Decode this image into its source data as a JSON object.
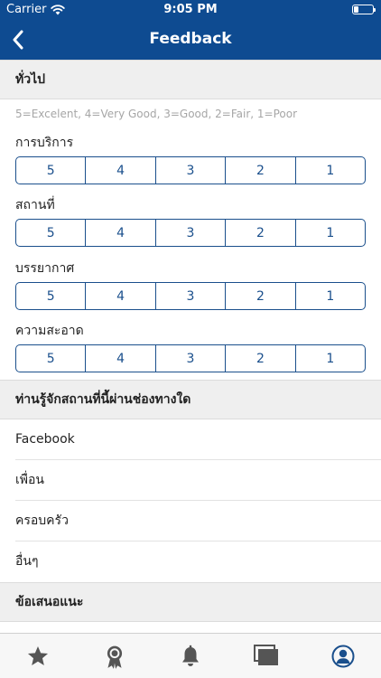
{
  "status_bar": {
    "carrier": "Carrier",
    "time": "9:05 PM",
    "battery_level": 0.25
  },
  "nav": {
    "title": "Feedback",
    "back_icon": "chevron-left-icon"
  },
  "colors": {
    "header_bg": "#0e4b91",
    "accent": "#1a4f8c",
    "section_bg": "#efefef",
    "tab_icon": "#555555"
  },
  "general": {
    "title": "ทั่วไป",
    "legend": "5=Excelent, 4=Very Good, 3=Good, 2=Fair, 1=Poor",
    "options": [
      "5",
      "4",
      "3",
      "2",
      "1"
    ],
    "questions": [
      {
        "label": "การบริการ"
      },
      {
        "label": "สถานที่"
      },
      {
        "label": "บรรยากาศ"
      },
      {
        "label": "ความสะอาด"
      }
    ]
  },
  "channel": {
    "title": "ท่านรู้จักสถานที่นี้ผ่านช่องทางใด",
    "options": [
      "Facebook",
      "เพื่อน",
      "ครอบครัว",
      "อื่นๆ"
    ]
  },
  "suggestion": {
    "title": "ข้อเสนอแนะ"
  },
  "tab_bar": {
    "items": [
      {
        "icon": "star-icon"
      },
      {
        "icon": "award-ribbon-icon"
      },
      {
        "icon": "bell-icon"
      },
      {
        "icon": "stacked-cards-icon"
      },
      {
        "icon": "profile-icon",
        "selected": true
      }
    ]
  }
}
